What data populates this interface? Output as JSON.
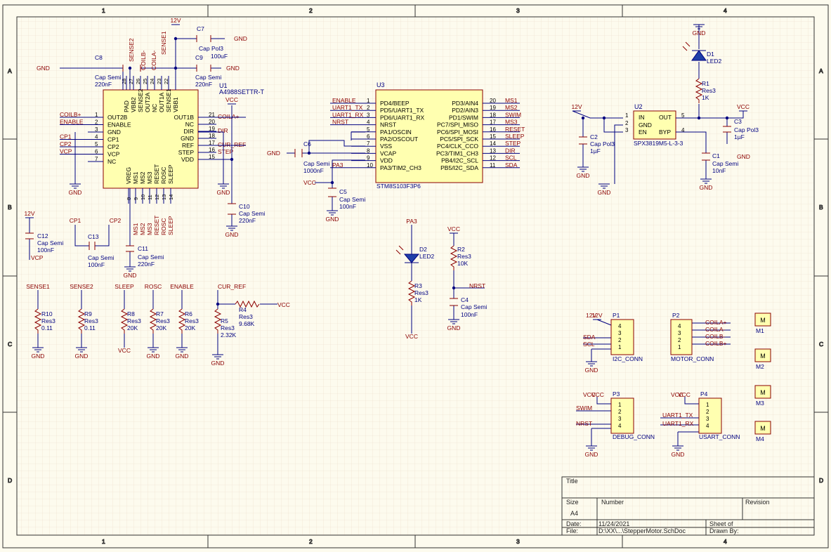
{
  "sheet": {
    "columns": [
      "1",
      "2",
      "3",
      "4"
    ],
    "rows": [
      "A",
      "B",
      "C",
      "D"
    ]
  },
  "title_block": {
    "title_label": "Title",
    "size_label": "Size",
    "size_value": "A4",
    "number_label": "Number",
    "revision_label": "Revision",
    "date_label": "Date:",
    "date_value": "11/24/2021",
    "sheet_label": "Sheet",
    "of_label": "of",
    "file_label": "File:",
    "file_value": "D:\\XX\\...\\StepperMotor.SchDoc",
    "drawn_label": "Drawn By:"
  },
  "u1": {
    "designator": "U1",
    "part": "A4988SETTR-T",
    "left_pins": [
      {
        "num": "1",
        "name": "OUT2B",
        "net": "COILB+"
      },
      {
        "num": "2",
        "name": "ENABLE",
        "net": "ENABLE"
      },
      {
        "num": "3",
        "name": "GND",
        "net": ""
      },
      {
        "num": "4",
        "name": "CP1",
        "net": "CP1"
      },
      {
        "num": "5",
        "name": "CP2",
        "net": "CP2"
      },
      {
        "num": "6",
        "name": "VCP",
        "net": "VCP"
      },
      {
        "num": "7",
        "name": "NC",
        "net": ""
      }
    ],
    "right_pins": [
      {
        "num": "21",
        "name": "OUT1B",
        "net": "COILA+"
      },
      {
        "num": "20",
        "name": "NC",
        "net": ""
      },
      {
        "num": "19",
        "name": "DIR",
        "net": "DIR"
      },
      {
        "num": "18",
        "name": "GND",
        "net": ""
      },
      {
        "num": "17",
        "name": "REF",
        "net": "CUR_REF"
      },
      {
        "num": "16",
        "name": "STEP",
        "net": "STEP"
      },
      {
        "num": "15",
        "name": "VDD",
        "net": ""
      }
    ],
    "top_pins": [
      {
        "num": "28",
        "name": "PAD"
      },
      {
        "num": "27",
        "name": "VBB2"
      },
      {
        "num": "26",
        "name": "SENSE2"
      },
      {
        "num": "25",
        "name": "OUT2A"
      },
      {
        "num": "24",
        "name": "NC"
      },
      {
        "num": "23",
        "name": "OUT1A"
      },
      {
        "num": "22",
        "name": "SENSE1"
      },
      {
        "num": "",
        "name": "VBB1"
      }
    ],
    "bottom_pins": [
      {
        "num": "8",
        "name": "VREG",
        "net": ""
      },
      {
        "num": "9",
        "name": "MS1",
        "net": "MS1"
      },
      {
        "num": "10",
        "name": "MS2",
        "net": "MS2"
      },
      {
        "num": "11",
        "name": "MS3",
        "net": "MS3"
      },
      {
        "num": "12",
        "name": "RESET",
        "net": "RESET"
      },
      {
        "num": "13",
        "name": "ROSC",
        "net": "ROSC"
      },
      {
        "num": "14",
        "name": "SLEEP",
        "net": "SLEEP"
      }
    ],
    "top_nets": {
      "sense2": "SENSE2",
      "coilb": "COILB-",
      "coila": "COILA-",
      "sense1": "SENSE1"
    }
  },
  "u3": {
    "designator": "U3",
    "part": "STM8S103F3P6",
    "left_pins": [
      {
        "num": "1",
        "name": "PD4/BEEP",
        "net": "ENABLE"
      },
      {
        "num": "2",
        "name": "PD5/UART1_TX",
        "net": "UART1_TX"
      },
      {
        "num": "3",
        "name": "PD6/UART1_RX",
        "net": "UART1_RX"
      },
      {
        "num": "4",
        "name": "NRST",
        "net": "NRST"
      },
      {
        "num": "5",
        "name": "PA1/OSCIN",
        "net": ""
      },
      {
        "num": "6",
        "name": "PA2/OSCOUT",
        "net": ""
      },
      {
        "num": "7",
        "name": "VSS",
        "net": ""
      },
      {
        "num": "8",
        "name": "VCAP",
        "net": ""
      },
      {
        "num": "9",
        "name": "VDD",
        "net": ""
      },
      {
        "num": "10",
        "name": "PA3/TIM2_CH3",
        "net": "PA3"
      }
    ],
    "right_pins": [
      {
        "num": "20",
        "name": "PD3/AIN4",
        "net": "MS1"
      },
      {
        "num": "19",
        "name": "PD2/AIN3",
        "net": "MS2"
      },
      {
        "num": "18",
        "name": "PD1/SWIM",
        "net": "SWIM"
      },
      {
        "num": "17",
        "name": "PC7/SPI_MISO",
        "net": "MS3"
      },
      {
        "num": "16",
        "name": "PC6/SPI_MOSI",
        "net": "RESET"
      },
      {
        "num": "15",
        "name": "PC5/SPI_SCK",
        "net": "SLEEP"
      },
      {
        "num": "14",
        "name": "PC4/CLK_CCO",
        "net": "STEP"
      },
      {
        "num": "13",
        "name": "PC3/TIM1_CH3",
        "net": "DIR"
      },
      {
        "num": "12",
        "name": "PB4/I2C_SCL",
        "net": "SCL"
      },
      {
        "num": "11",
        "name": "PB5/I2C_SDA",
        "net": "SDA"
      }
    ]
  },
  "u2": {
    "designator": "U2",
    "part": "SPX3819M5-L-3-3",
    "pins": [
      {
        "num": "1",
        "name": "IN"
      },
      {
        "num": "2",
        "name": "GND"
      },
      {
        "num": "3",
        "name": "EN"
      },
      {
        "num": "5",
        "name": "OUT"
      },
      {
        "num": "4",
        "name": "BYP"
      }
    ]
  },
  "caps": {
    "c7": {
      "ref": "C7",
      "type": "Cap Pol3",
      "value": "100uF"
    },
    "c8": {
      "ref": "C8",
      "type": "Cap Semi",
      "value": "220nF"
    },
    "c9": {
      "ref": "C9",
      "type": "Cap Semi",
      "value": "220nF"
    },
    "c10": {
      "ref": "C10",
      "type": "Cap Semi",
      "value": "220nF"
    },
    "c11": {
      "ref": "C11",
      "type": "Cap Semi",
      "value": "220nF"
    },
    "c12": {
      "ref": "C12",
      "type": "Cap Semi",
      "value": "100nF"
    },
    "c13": {
      "ref": "C13",
      "type": "Cap Semi",
      "value": "100nF"
    },
    "c6": {
      "ref": "C6",
      "type": "Cap Semi",
      "value": "1000nF"
    },
    "c5": {
      "ref": "C5",
      "type": "Cap Semi",
      "value": "100nF"
    },
    "c4": {
      "ref": "C4",
      "type": "Cap Semi",
      "value": "100nF"
    },
    "c2": {
      "ref": "C2",
      "type": "Cap Pol3",
      "value": "1µF"
    },
    "c3": {
      "ref": "C3",
      "type": "Cap Pol3",
      "value": "1µF"
    },
    "c1": {
      "ref": "C1",
      "type": "Cap Semi",
      "value": "10nF"
    }
  },
  "resistors": {
    "r10": {
      "ref": "R10",
      "type": "Res3",
      "value": "0.11",
      "net": "SENSE1"
    },
    "r9": {
      "ref": "R9",
      "type": "Res3",
      "value": "0.11",
      "net": "SENSE2"
    },
    "r8": {
      "ref": "R8",
      "type": "Res3",
      "value": "20K",
      "net": "SLEEP"
    },
    "r7": {
      "ref": "R7",
      "type": "Res3",
      "value": "20K",
      "net": "ROSC"
    },
    "r6": {
      "ref": "R6",
      "type": "Res3",
      "value": "20K",
      "net": "ENABLE"
    },
    "r5": {
      "ref": "R5",
      "type": "Res3",
      "value": "2.32K"
    },
    "r4": {
      "ref": "R4",
      "type": "Res3",
      "value": "9.68K"
    },
    "r3": {
      "ref": "R3",
      "type": "Res3",
      "value": "1K"
    },
    "r2": {
      "ref": "R2",
      "type": "Res3",
      "value": "10K"
    },
    "r1": {
      "ref": "R1",
      "type": "Res3",
      "value": "1K"
    }
  },
  "leds": {
    "d1": {
      "ref": "D1",
      "type": "LED2"
    },
    "d2": {
      "ref": "D2",
      "type": "LED2"
    }
  },
  "connectors": {
    "p1": {
      "ref": "P1",
      "name": "I2C_CONN",
      "pins": [
        "4",
        "3",
        "2",
        "1"
      ],
      "nets": [
        "12V",
        "SDA",
        "SCL"
      ]
    },
    "p2": {
      "ref": "P2",
      "name": "MOTOR_CONN",
      "pins": [
        "4",
        "3",
        "2",
        "1"
      ],
      "nets": [
        "COILA+",
        "COILA-",
        "COILB-",
        "COILB+"
      ]
    },
    "p3": {
      "ref": "P3",
      "name": "DEBUG_CONN",
      "pins": [
        "1",
        "2",
        "3",
        "4"
      ],
      "nets": [
        "VCC",
        "SWIM",
        "NRST"
      ]
    },
    "p4": {
      "ref": "P4",
      "name": "USART_CONN",
      "pins": [
        "1",
        "2",
        "3",
        "4"
      ],
      "nets": [
        "VCC",
        "UART1_TX",
        "UART1_RX"
      ]
    }
  },
  "mounts": [
    {
      "ref": "M1",
      "glyph": "M"
    },
    {
      "ref": "M2",
      "glyph": "M"
    },
    {
      "ref": "M3",
      "glyph": "M"
    },
    {
      "ref": "M4",
      "glyph": "M"
    }
  ],
  "nets": {
    "gnd": "GND",
    "vcc": "VCC",
    "v12": "12V",
    "cur_ref": "CUR_REF",
    "pa3": "PA3",
    "nrst": "NRST",
    "cp1": "CP1",
    "cp2": "CP2",
    "vcp": "VCP"
  }
}
